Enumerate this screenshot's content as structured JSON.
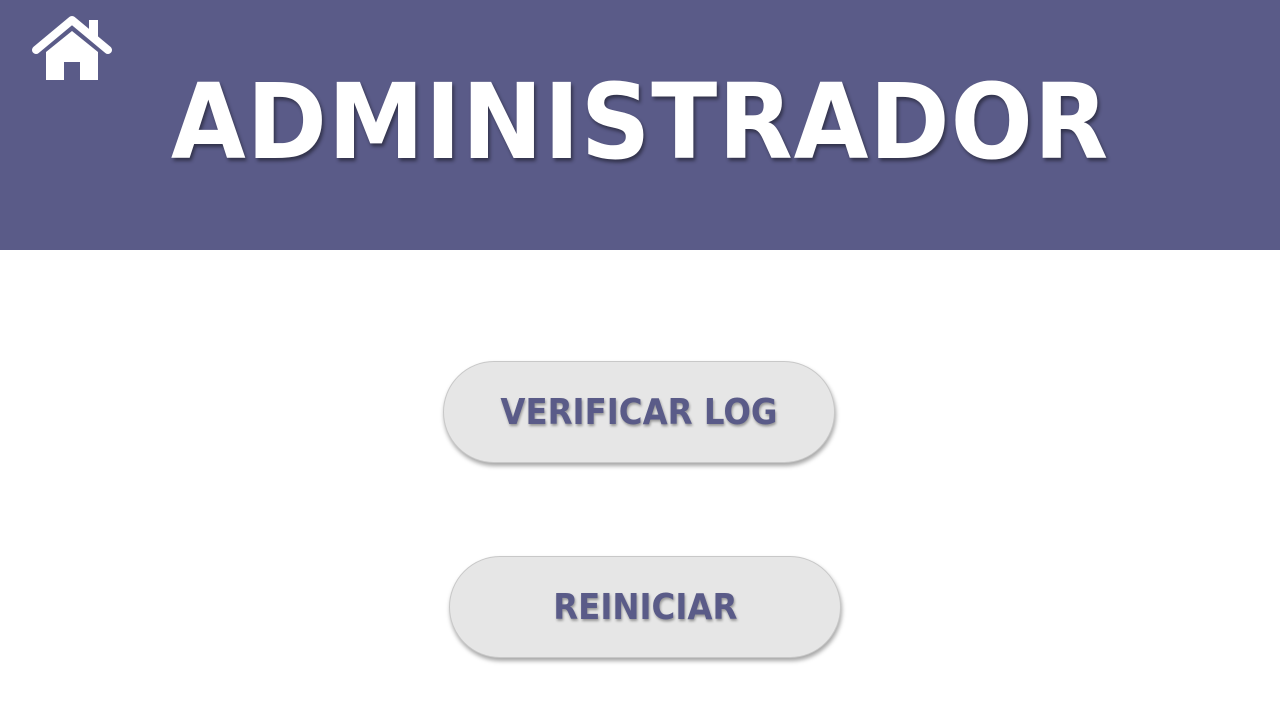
{
  "header": {
    "title": "ADMINISTRADOR",
    "home_icon": "home-icon",
    "background_color": "#5a5b88"
  },
  "actions": {
    "verify_log_label": "VERIFICAR LOG",
    "restart_label": "REINICIAR",
    "button_color": "#e6e6e6",
    "button_text_color": "#5a5b88"
  }
}
